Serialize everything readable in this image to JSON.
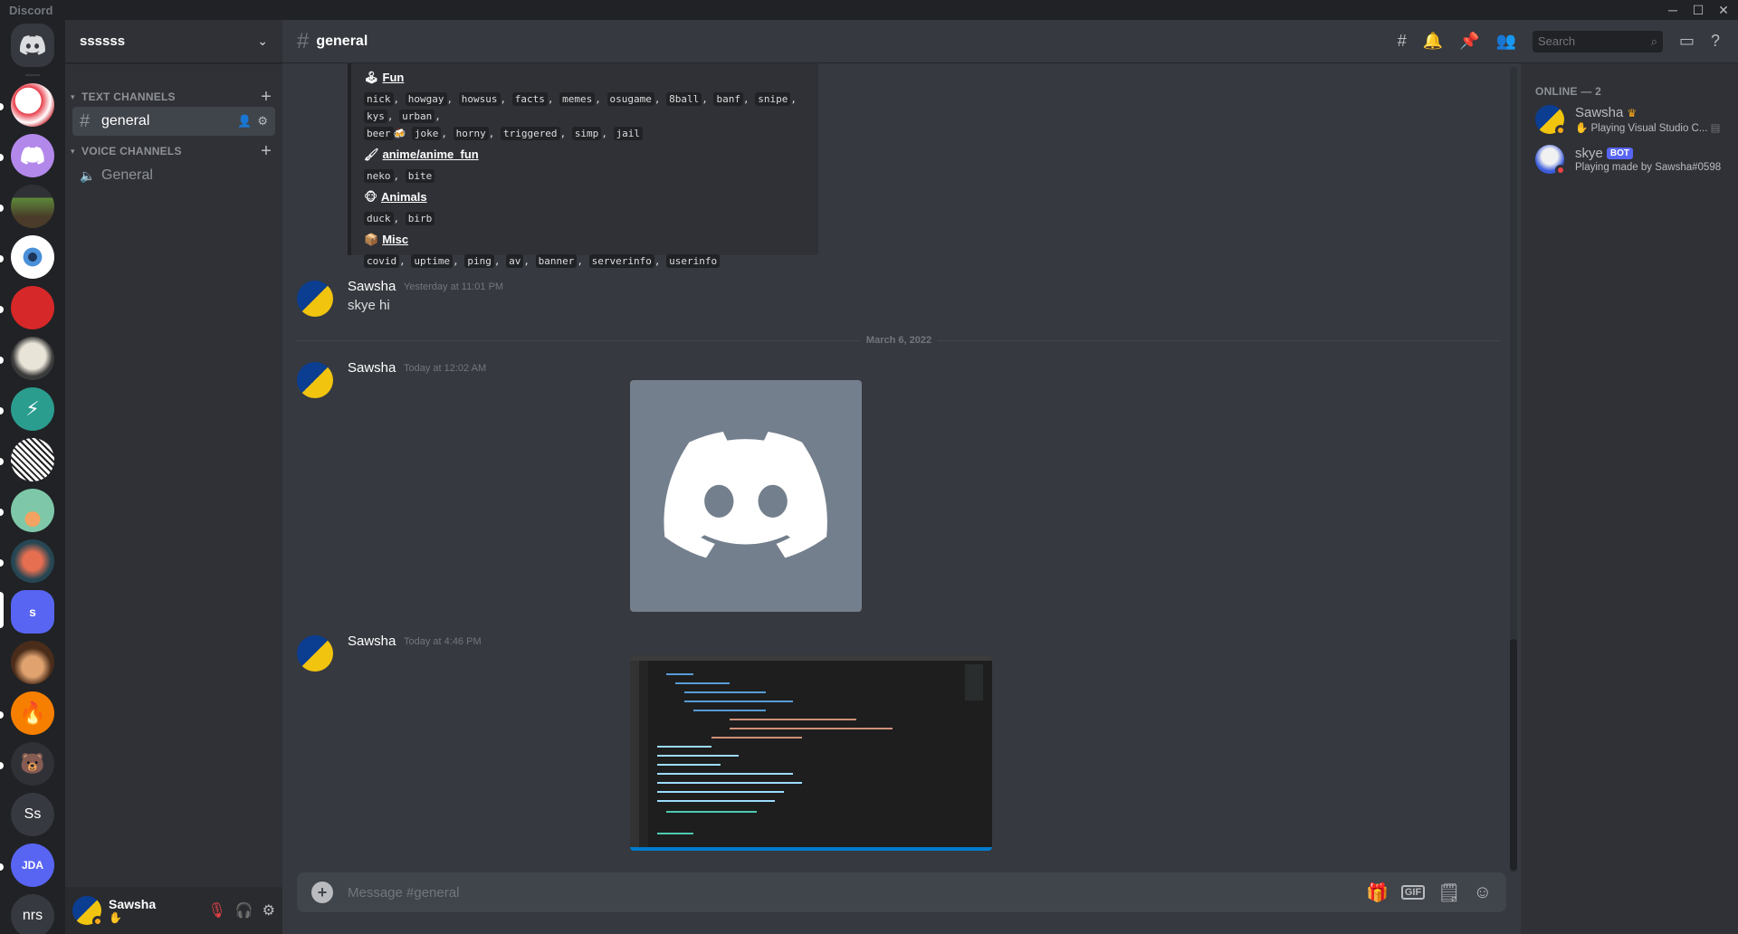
{
  "window": {
    "app_title": "Discord"
  },
  "server": {
    "name": "ssssss"
  },
  "sidebar": {
    "text_category": "TEXT CHANNELS",
    "voice_category": "VOICE CHANNELS",
    "text_channels": [
      {
        "label": "general"
      }
    ],
    "voice_channels": [
      {
        "label": "General"
      }
    ]
  },
  "server_list": [
    {
      "label": "s"
    },
    {
      "label": "Ss"
    },
    {
      "label": "JDA"
    },
    {
      "label": "nrs"
    }
  ],
  "user_panel": {
    "username": "Sawsha"
  },
  "channel": {
    "name": "general",
    "search_placeholder": "Search"
  },
  "embed": {
    "fields": [
      {
        "name": "Fun",
        "values": [
          "nick",
          "howgay",
          "howsus",
          "facts",
          "memes",
          "osugame",
          "8ball",
          "banf",
          "snipe",
          "kys",
          "urban",
          "beer",
          "joke",
          "horny",
          "triggered",
          "simp",
          "jail"
        ]
      },
      {
        "name": "anime/anime_fun",
        "values": [
          "neko",
          "bite"
        ]
      },
      {
        "name": "Animals",
        "values": [
          "duck",
          "birb"
        ]
      },
      {
        "name": "Misc",
        "values": [
          "covid",
          "uptime",
          "ping",
          "av",
          "banner",
          "serverinfo",
          "userinfo"
        ]
      }
    ]
  },
  "messages": [
    {
      "author": "Sawsha",
      "time": "Yesterday at 11:01 PM",
      "text": "skye hi"
    },
    {
      "author": "Sawsha",
      "time": "Today at 12:02 AM",
      "text": ""
    },
    {
      "author": "Sawsha",
      "time": "Today at 4:46 PM",
      "text": ""
    }
  ],
  "date_divider": "March 6, 2022",
  "composer": {
    "placeholder": "Message #general",
    "gif_label": "GIF"
  },
  "members": {
    "heading": "ONLINE — 2",
    "list": [
      {
        "name": "Sawsha",
        "activity": "Playing Visual Studio C...",
        "status_color": "#faa81a"
      },
      {
        "name": "skye",
        "tag": "BOT",
        "activity": "Playing made by Sawsha#0598",
        "status_color": "#ed4245"
      }
    ]
  },
  "colors": {
    "blurple": "#5865f2",
    "background": "#36393f",
    "sidebar": "#2f3136",
    "rail": "#202225"
  }
}
